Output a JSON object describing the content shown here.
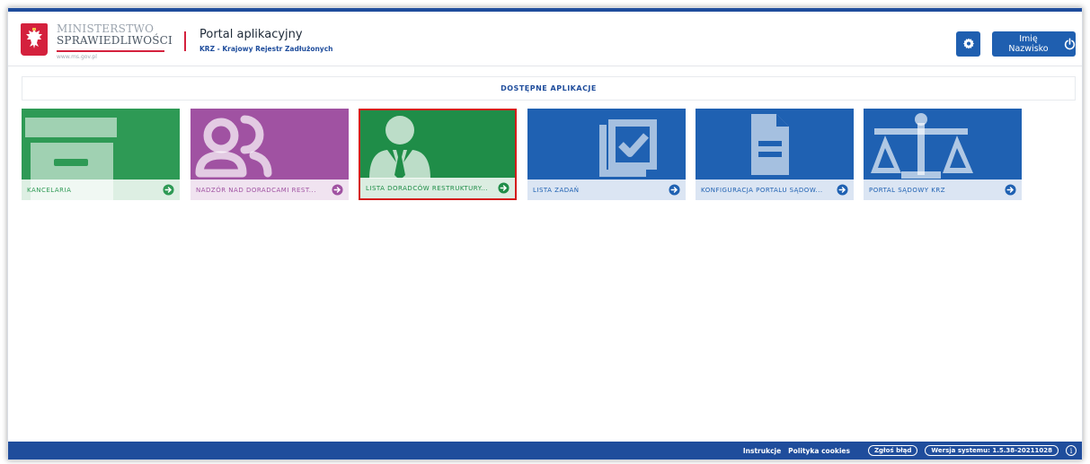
{
  "header": {
    "logo_line1": "MINISTERSTWO",
    "logo_line2": "SPRAWIEDLIWOŚCI",
    "logo_url": "www.ms.gov.pl",
    "portal_title": "Portal aplikacyjny",
    "portal_subtitle": "KRZ - Krajowy Rejestr Zadłużonych",
    "settings_icon": "gear-icon",
    "user_label": "Imię Nazwisko",
    "logout_icon": "power-icon"
  },
  "main": {
    "section_title": "DOSTĘPNE APLIKACJE",
    "tiles": [
      {
        "label": "KANCELARIA",
        "icon": "archive-box-icon",
        "color": "#2e9a55"
      },
      {
        "label": "NADZÓR NAD DORADCAMI REST...",
        "icon": "users-icon",
        "color": "#a052a2"
      },
      {
        "label": "LISTA DORADCÓW RESTRUKTURY...",
        "icon": "advisor-icon",
        "color": "#1f8d48",
        "selected": true
      },
      {
        "label": "LISTA ZADAŃ",
        "icon": "task-checklist-icon",
        "color": "#1f61b2"
      },
      {
        "label": "KONFIGURACJA PORTALU SĄDOW...",
        "icon": "document-icon",
        "color": "#1f61b2"
      },
      {
        "label": "PORTAL SĄDOWY KRZ",
        "icon": "scales-icon",
        "color": "#1f61b2"
      }
    ]
  },
  "footer": {
    "instructions": "Instrukcje",
    "cookies": "Polityka cookies",
    "report_bug": "Zgłoś błąd",
    "version": "Wersja systemu: 1.5.38-20211028",
    "info_icon": "info-icon",
    "info_glyph": "i"
  },
  "colors": {
    "brand_blue": "#1f4d9c",
    "brand_red": "#d4213d",
    "selected_border": "#d41c1c"
  }
}
